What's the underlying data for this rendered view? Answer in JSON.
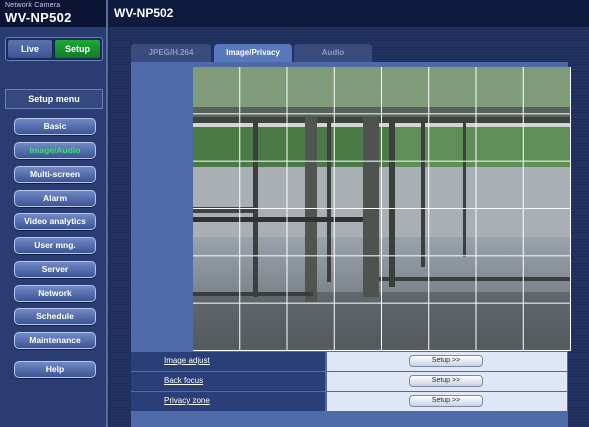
{
  "header": {
    "brand_sub": "Network Camera",
    "brand_model": "WV-NP502",
    "page_model": "WV-NP502"
  },
  "sidebar": {
    "mode_tabs": {
      "live": "Live",
      "setup": "Setup",
      "active": "Setup"
    },
    "menu_title": "Setup menu",
    "items": [
      {
        "label": "Basic"
      },
      {
        "label": "Image/Audio",
        "active": true
      },
      {
        "label": "Multi-screen"
      },
      {
        "label": "Alarm"
      },
      {
        "label": "Video analytics"
      },
      {
        "label": "User mng."
      },
      {
        "label": "Server"
      },
      {
        "label": "Network"
      },
      {
        "label": "Schedule"
      },
      {
        "label": "Maintenance"
      }
    ],
    "help": "Help"
  },
  "tabs": [
    {
      "label": "JPEG/H.264",
      "active": false
    },
    {
      "label": "Image/Privacy",
      "active": true
    },
    {
      "label": "Audio",
      "active": false
    }
  ],
  "setup_rows": [
    {
      "label": "Image adjust",
      "button": "Setup >>"
    },
    {
      "label": "Back focus",
      "button": "Setup >>"
    },
    {
      "label": "Privacy zone",
      "button": "Setup >>"
    }
  ],
  "colors": {
    "active_menu_text": "#35e06a",
    "setup_tab": "#1fa83a",
    "active_tab": "#5878bb"
  }
}
